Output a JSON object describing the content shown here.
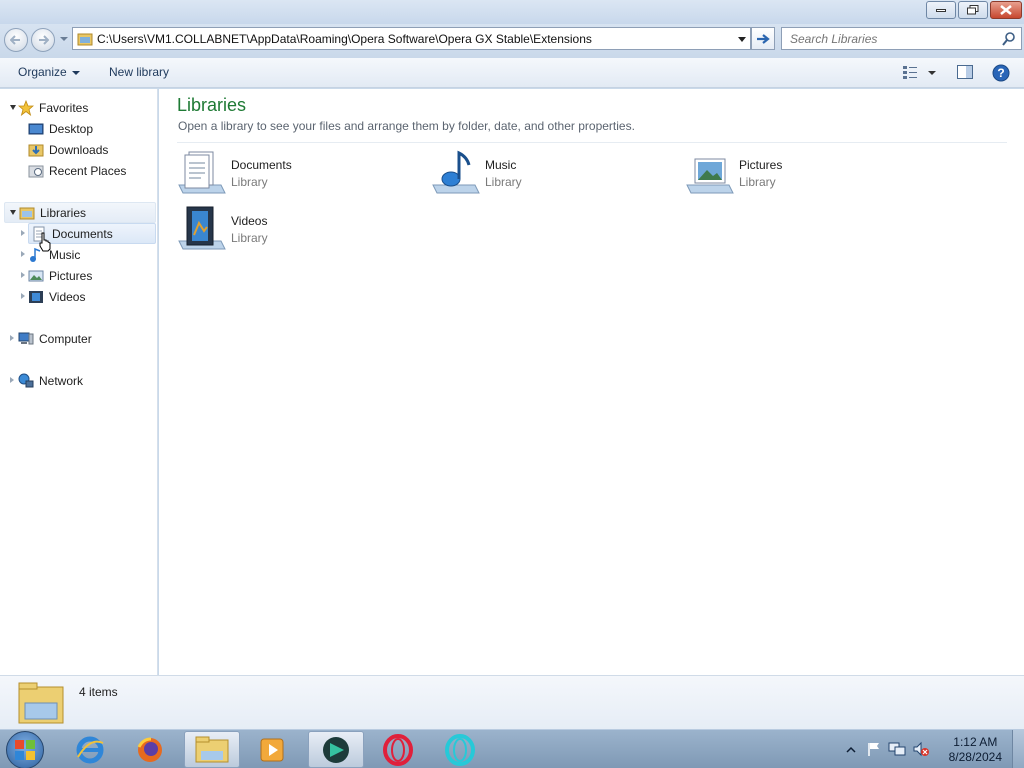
{
  "window": {
    "address_path": "C:\\Users\\VM1.COLLABNET\\AppData\\Roaming\\Opera Software\\Opera GX Stable\\Extensions",
    "search_placeholder": "Search Libraries"
  },
  "commandbar": {
    "organize": "Organize",
    "new_library": "New library"
  },
  "nav": {
    "favorites": "Favorites",
    "desktop": "Desktop",
    "downloads": "Downloads",
    "recent_places": "Recent Places",
    "libraries": "Libraries",
    "documents": "Documents",
    "music": "Music",
    "pictures": "Pictures",
    "videos": "Videos",
    "computer": "Computer",
    "network": "Network"
  },
  "content": {
    "title": "Libraries",
    "subtitle": "Open a library to see your files and arrange them by folder, date, and other properties.",
    "tiles": [
      {
        "name": "Documents",
        "type": "Library",
        "icon": "documents-library-icon"
      },
      {
        "name": "Music",
        "type": "Library",
        "icon": "music-library-icon"
      },
      {
        "name": "Pictures",
        "type": "Library",
        "icon": "pictures-library-icon"
      },
      {
        "name": "Videos",
        "type": "Library",
        "icon": "videos-library-icon"
      }
    ]
  },
  "details": {
    "count": "4 items"
  },
  "taskbar": {
    "apps": [
      "internet-explorer-icon",
      "firefox-icon",
      "file-explorer-icon",
      "media-player-icon",
      "app-icon",
      "opera-icon",
      "opera-gx-icon"
    ],
    "time": "1:12 AM",
    "date": "8/28/2024"
  },
  "colors": {
    "title_green": "#1e7a34",
    "window_frame": "#c9d9ea",
    "taskbar": "#8aa3bf"
  }
}
